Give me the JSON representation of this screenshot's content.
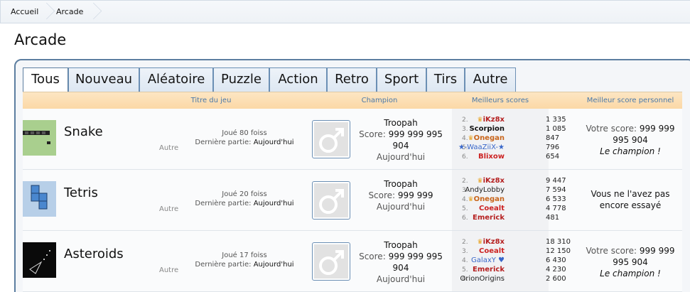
{
  "breadcrumb": {
    "home": "Accueil",
    "current": "Arcade"
  },
  "page_title": "Arcade",
  "tabs": [
    "Tous",
    "Nouveau",
    "Aléatoire",
    "Puzzle",
    "Action",
    "Retro",
    "Sport",
    "Tirs",
    "Autre"
  ],
  "headers": {
    "title": "Titre du jeu",
    "champion": "Champion",
    "best": "Meilleurs scores",
    "personal": "Meilleur score personnel"
  },
  "games": [
    {
      "name": "Snake",
      "category": "Autre",
      "played_label": "Joué 80 foiss",
      "last_label": "Dernière partie:",
      "last_value": "Aujourd'hui",
      "champion": "Troopah",
      "score_label": "Score:",
      "score": "999 999 995 904",
      "date": "Aujourd'hui",
      "scores": [
        {
          "rank": "2.",
          "name": "iKz8x",
          "score": "1 335"
        },
        {
          "rank": "3.",
          "name": "Scorpion",
          "score": "1 085"
        },
        {
          "rank": "4.",
          "name": "Onegan",
          "score": "847"
        },
        {
          "rank": "5.",
          "name": "★-WaaZiiX-★",
          "score": "796"
        },
        {
          "rank": "6.",
          "name": "Blixow",
          "score": "654"
        }
      ],
      "personal_label": "Votre score:",
      "personal_score": "999 999 995 904",
      "personal_note": "Le champion !"
    },
    {
      "name": "Tetris",
      "category": "Autre",
      "played_label": "Joué 20 foiss",
      "last_label": "Dernière partie:",
      "last_value": "Aujourd'hui",
      "champion": "Troopah",
      "score_label": "Score:",
      "score": "999 999",
      "date": "Aujourd'hui",
      "scores": [
        {
          "rank": "2.",
          "name": "iKz8x",
          "score": "9 447"
        },
        {
          "rank": "3.",
          "name": "AndyLobby",
          "score": "7 594"
        },
        {
          "rank": "4.",
          "name": "Onegan",
          "score": "6 533"
        },
        {
          "rank": "5.",
          "name": "Coealt",
          "score": "4 778"
        },
        {
          "rank": "6.",
          "name": "Emerick",
          "score": "481"
        }
      ],
      "personal_text": "Vous ne l'avez pas encore essayé"
    },
    {
      "name": "Asteroids",
      "category": "Autre",
      "played_label": "Joué 17 foiss",
      "last_label": "Dernière partie:",
      "last_value": "Aujourd'hui",
      "champion": "Troopah",
      "score_label": "Score:",
      "score": "999 999 995 904",
      "date": "Aujourd'hui",
      "scores": [
        {
          "rank": "2.",
          "name": "iKz8x",
          "score": "18 310"
        },
        {
          "rank": "3.",
          "name": "Coealt",
          "score": "12 150"
        },
        {
          "rank": "4.",
          "name": "GalaxY ♥",
          "score": "6 430"
        },
        {
          "rank": "5.",
          "name": "Emerick",
          "score": "4 230"
        },
        {
          "rank": "6.",
          "name": "OrionOrigins",
          "score": "2 600"
        }
      ],
      "personal_label": "Votre score:",
      "personal_score": "999 999 995 904",
      "personal_note": "Le champion !"
    }
  ],
  "colors": {
    "header_text": "#4978a9",
    "tab_border": "#6b8fb4",
    "header_bg": "#fbd8a6"
  },
  "icons": [
    "male-symbol-icon",
    "crown-icon"
  ]
}
